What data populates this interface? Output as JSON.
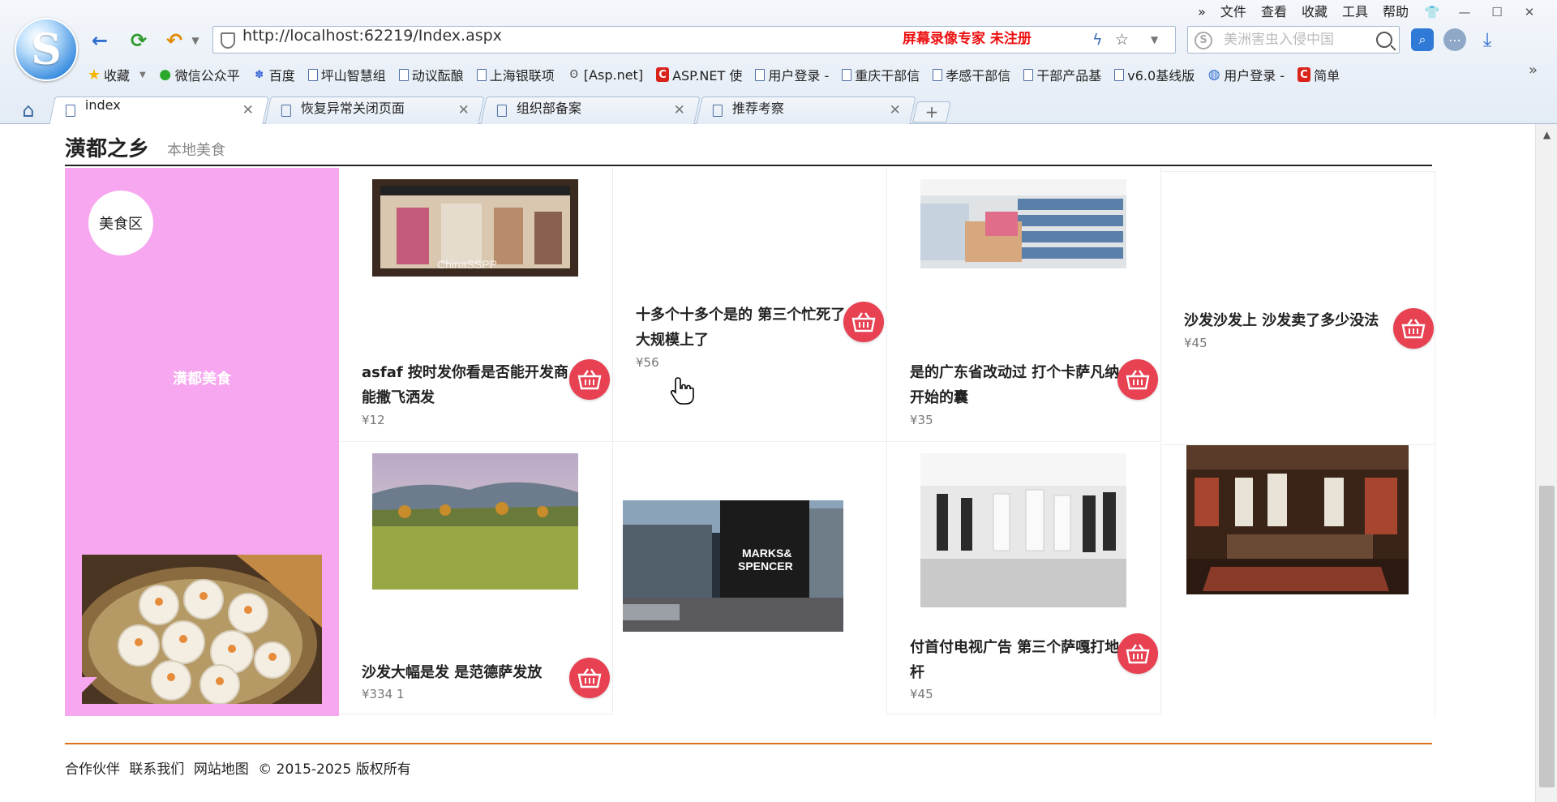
{
  "browser": {
    "menu": [
      "文件",
      "查看",
      "收藏",
      "工具",
      "帮助"
    ],
    "address_url": "http://localhost:62219/Index.aspx",
    "watermark": "屏幕录像专家  未注册",
    "search_placeholder": "美洲害虫入侵中国",
    "bookmarks": [
      {
        "label": "收藏",
        "icon": "star-icon"
      },
      {
        "label": "微信公众平",
        "icon": "wechat-icon"
      },
      {
        "label": "百度",
        "icon": "baidu-icon"
      },
      {
        "label": "坪山智慧组",
        "icon": "page-icon"
      },
      {
        "label": "动议酝酿",
        "icon": "page-icon"
      },
      {
        "label": "上海银联项",
        "icon": "page-icon"
      },
      {
        "label": "[Asp.net]",
        "icon": "page-icon"
      },
      {
        "label": "ASP.NET 使",
        "icon": "page-icon"
      },
      {
        "label": "用户登录 -",
        "icon": "page-icon"
      },
      {
        "label": "重庆干部信",
        "icon": "page-icon"
      },
      {
        "label": "孝感干部信",
        "icon": "page-icon"
      },
      {
        "label": "干部产品基",
        "icon": "page-icon"
      },
      {
        "label": "v6.0基线版",
        "icon": "page-icon"
      },
      {
        "label": "用户登录 -",
        "icon": "globe-icon"
      },
      {
        "label": "简单",
        "icon": "page-icon"
      }
    ],
    "tabs": [
      {
        "label": "index",
        "active": true
      },
      {
        "label": "恢复异常关闭页面",
        "active": false
      },
      {
        "label": "组织部备案",
        "active": false
      },
      {
        "label": "推荐考察",
        "active": false
      }
    ],
    "new_tab_label": "+"
  },
  "section": {
    "title": "潢都之乡",
    "subtitle": "本地美食"
  },
  "promo": {
    "badge": "美食区",
    "label": "潢都美食",
    "accent_color": "#f6a7ef"
  },
  "products": [
    {
      "name": "asfaf 按时发你看是否能开发商能撒飞洒发",
      "price": "¥12",
      "image": "mall-storefront"
    },
    {
      "name": "十多个十多个是的 第三个忙死了大规模上了",
      "price": "¥56",
      "image": ""
    },
    {
      "name": "是的广东省改动过 打个卡萨凡纳开始的囊",
      "price": "¥35",
      "image": "supermarket-shelves"
    },
    {
      "name": "沙发沙发上 沙发卖了多少没法",
      "price": "¥45",
      "image": ""
    },
    {
      "name": "沙发大幅是发 是范德萨发放",
      "price": "¥334 1",
      "image": "hill-landscape"
    },
    {
      "name": "",
      "price": "",
      "image": "marks-spencer-store"
    },
    {
      "name": "付首付电视广告 第三个萨嘎打地杆",
      "price": "¥45",
      "image": "clothing-showroom"
    },
    {
      "name": "",
      "price": "",
      "image": "clothing-store-interior"
    }
  ],
  "cart_color": "#e74152",
  "footer": {
    "links": [
      "合作伙伴",
      "联系我们",
      "网站地图"
    ],
    "copyright": "© 2015-2025 版权所有"
  }
}
